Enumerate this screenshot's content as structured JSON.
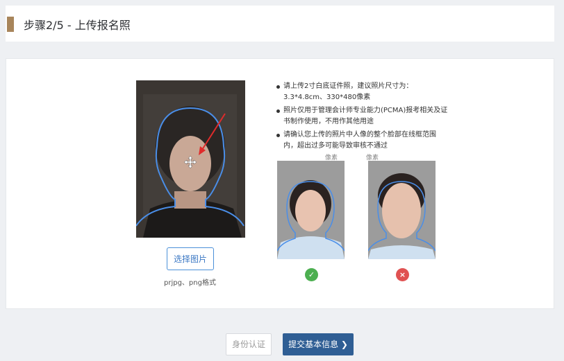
{
  "header": {
    "title": "步骤2/5 - 上传报名照",
    "accent_color": "#a8855b"
  },
  "upload": {
    "choose_label": "选择图片",
    "format_note": "prjpg、png格式"
  },
  "instructions": [
    "请上传2寸白底证件照，建议照片尺寸为：3.3*4.8cm、330*480像素",
    "照片仅用于管理会计师专业能力(PCMA)报考相关及证书制作使用，不用作其他用途",
    "请确认您上传的照片中人像的整个脸部在线框范围内，超出过多可能导致审核不通过"
  ],
  "samples": [
    {
      "caption": "像素",
      "status": "correct",
      "icon": "check-icon",
      "color": "#4caf50",
      "glyph": "✓"
    },
    {
      "caption": "像素",
      "status": "incorrect",
      "icon": "cross-icon",
      "color": "#e05252",
      "glyph": "×"
    }
  ],
  "footer": {
    "identity_label": "身份认证",
    "submit_label": "提交基本信息 ❯",
    "submit_color": "#2f5e94"
  }
}
